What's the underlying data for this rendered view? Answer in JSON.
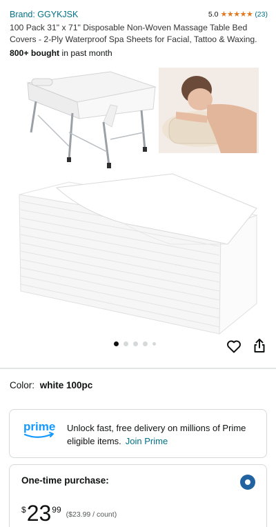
{
  "brand": {
    "label": "Brand: GGYKJSK"
  },
  "rating": {
    "score": "5.0",
    "stars": "★★★★★",
    "count": "(23)"
  },
  "product": {
    "title": "100 Pack 31\" x 71\" Disposable Non-Woven Massage Table Bed Covers - 2-Ply Waterproof Spa Sheets for Facial, Tattoo & Waxing.",
    "bought_bold": "800+ bought",
    "bought_rest": " in past month"
  },
  "gallery": {
    "image_count": 5,
    "active_index": 0
  },
  "color": {
    "label": "Color:",
    "value": "white 100pc"
  },
  "prime": {
    "logo_text": "prime",
    "message": "Unlock fast, free delivery on millions of Prime eligible items.",
    "join_label": "Join Prime",
    "accent": "#007185"
  },
  "purchase": {
    "title": "One-time purchase:",
    "currency": "$",
    "whole": "23",
    "fraction": "99",
    "unit_price": "($23.99 / count)",
    "selected": true
  },
  "colors": {
    "link": "#007185",
    "star": "#de7921",
    "radio": "#2162a1",
    "text": "#0f1111"
  }
}
